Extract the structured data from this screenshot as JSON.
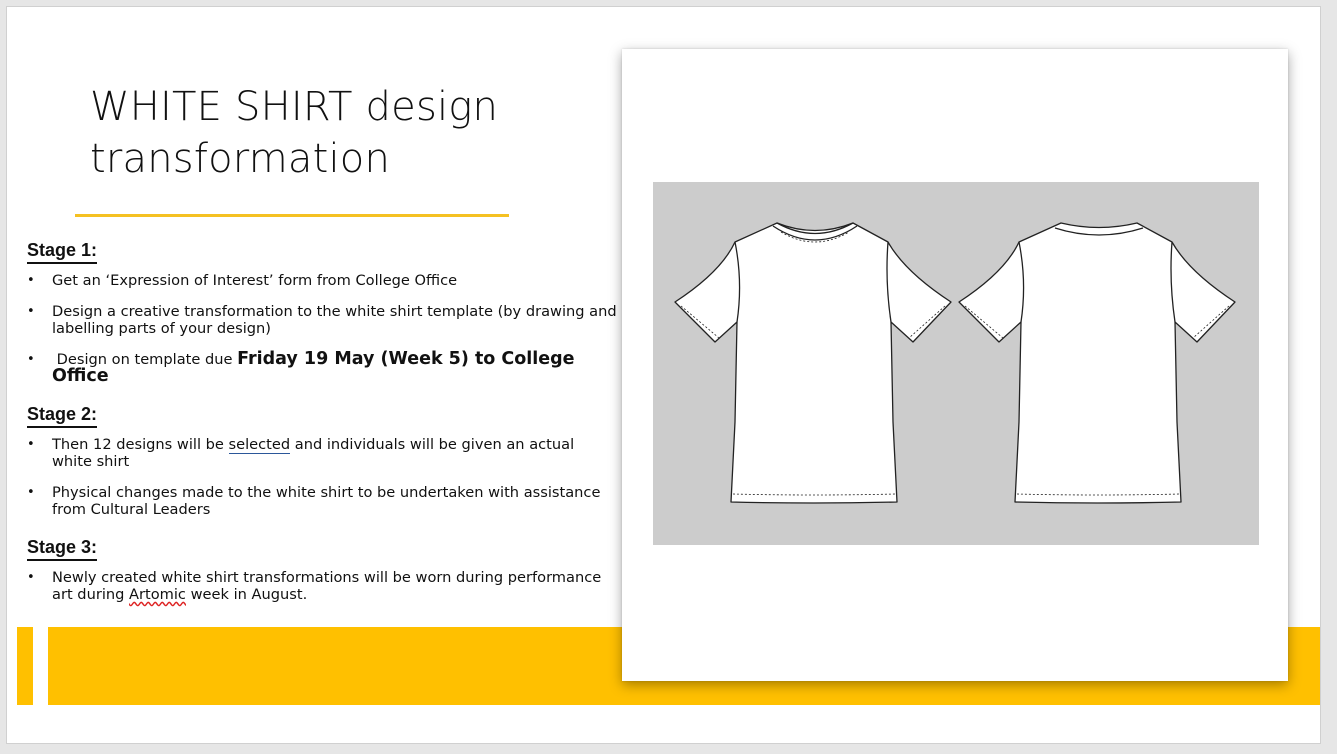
{
  "slide": {
    "title_line1": "WHITE SHIRT design",
    "title_line2": "transformation"
  },
  "stages": [
    {
      "heading": "Stage 1:",
      "items": [
        "Get an ‘Expression of Interest’ form from College Office",
        "Design a creative transformation to the white shirt template (by drawing and labelling parts of your design)"
      ],
      "due_prefix": " Design on template due ",
      "due_bold": "Friday 19 May (Week 5) to College Office"
    },
    {
      "heading": "Stage 2:",
      "item1_pre": "Then 12 designs will be ",
      "item1_link": "selected",
      "item1_post": " and individuals will be given an actual white shirt",
      "item2": "Physical changes made to the white shirt to be undertaken with assistance from Cultural Leaders"
    },
    {
      "heading": "Stage 3:",
      "item1_pre": "Newly created white shirt transformations will be worn during performance art during ",
      "item1_flag": "Artomic",
      "item1_post": " week in August."
    }
  ],
  "colors": {
    "accent": "#ffc000",
    "rule": "#f5c122",
    "image_bg": "#cccccc"
  },
  "image": {
    "icon": "tshirt-template-icon"
  }
}
